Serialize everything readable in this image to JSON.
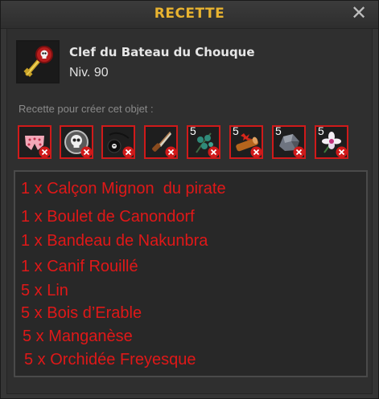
{
  "window": {
    "title": "RECETTE",
    "close_glyph": "✕"
  },
  "item": {
    "name": "Clef du Bateau du Chouque",
    "level": "Niv. 90",
    "icon": "pirate-key-icon"
  },
  "recipe_label": "Recette pour créer cet objet :",
  "ingredients": [
    {
      "icon": "pink-underpants-icon",
      "qty": ""
    },
    {
      "icon": "skull-cannonball-icon",
      "qty": ""
    },
    {
      "icon": "eyepatch-icon",
      "qty": ""
    },
    {
      "icon": "rusty-knife-icon",
      "qty": ""
    },
    {
      "icon": "flax-icon",
      "qty": "5"
    },
    {
      "icon": "maple-wood-icon",
      "qty": "5"
    },
    {
      "icon": "manganese-ore-icon",
      "qty": "5"
    },
    {
      "icon": "orchid-flower-icon",
      "qty": "5"
    }
  ],
  "notes": [
    "1 x Calçon Mignon  du pirate",
    "1 x Boulet de Canondorf",
    "1 x Bandeau de Nakunbra",
    "1 x Canif Rouillé",
    "5 x Lin",
    "5 x Bois d’Erable",
    "5 x Manganèse",
    "5 x Orchidée Freyesque"
  ],
  "colors": {
    "title": "#e8b330",
    "slot_border": "#d01a1a",
    "note_text": "#e01818"
  }
}
